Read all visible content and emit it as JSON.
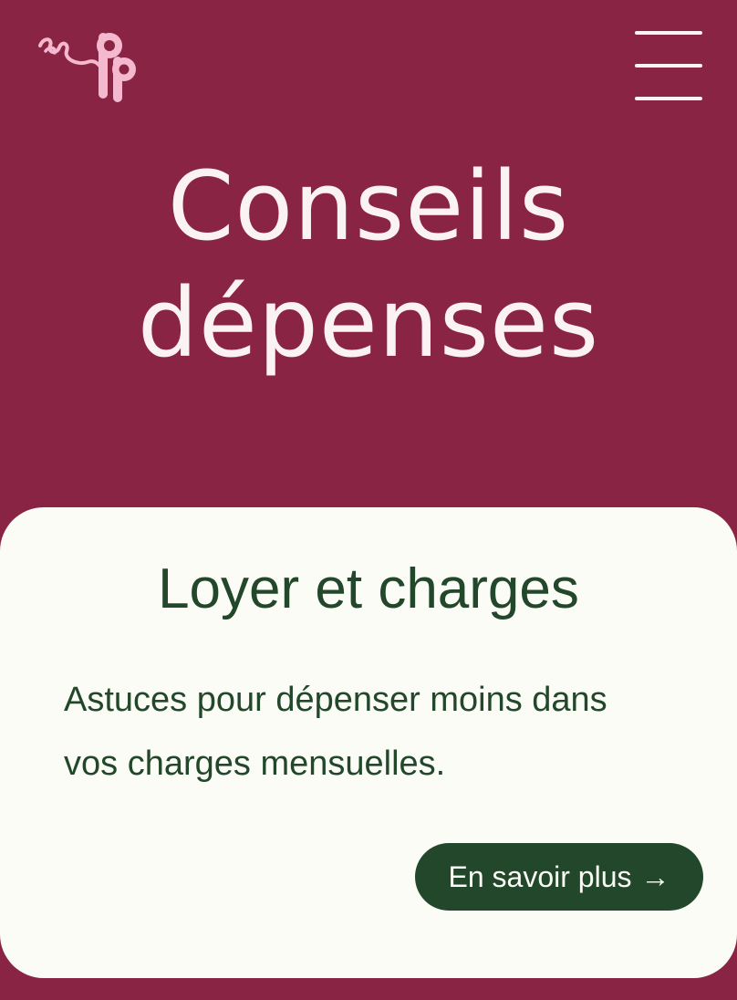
{
  "colors": {
    "background": "#8a2445",
    "hero_text": "#fbf2f4",
    "logo_pink": "#f4b8cf",
    "card_background": "#fbfcf6",
    "card_text": "#22472a",
    "button_background": "#22472a",
    "button_text": "#fbfcf6"
  },
  "header": {
    "logo_icon": "epp-logo-icon",
    "menu_icon": "hamburger-menu-icon"
  },
  "hero": {
    "title_line1": "Conseils",
    "title_line2": "dépenses"
  },
  "card": {
    "title": "Loyer et charges",
    "description": "Astuces pour dépenser moins dans vos charges mensuelles.",
    "button_label": "En savoir plus",
    "button_arrow": "→"
  }
}
